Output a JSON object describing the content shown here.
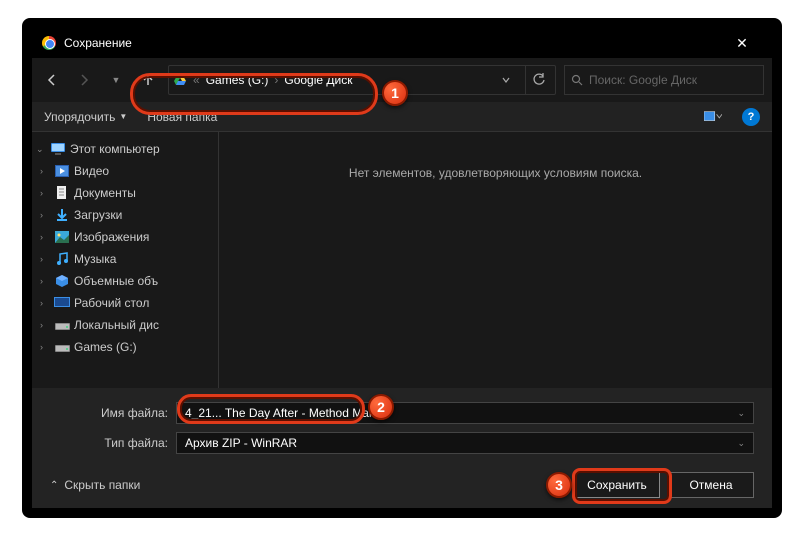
{
  "titlebar": {
    "title": "Сохранение"
  },
  "breadcrumb": {
    "prefix": "«",
    "seg1": "Games (G:)",
    "seg2": "Google Диск"
  },
  "search": {
    "placeholder": "Поиск: Google Диск"
  },
  "toolbar": {
    "organize": "Упорядочить",
    "new_folder": "Новая папка"
  },
  "sidebar": {
    "root": "Этот компьютер",
    "items": [
      {
        "label": "Видео"
      },
      {
        "label": "Документы"
      },
      {
        "label": "Загрузки"
      },
      {
        "label": "Изображения"
      },
      {
        "label": "Музыка"
      },
      {
        "label": "Объемные объ"
      },
      {
        "label": "Рабочий стол"
      },
      {
        "label": "Локальный дис"
      },
      {
        "label": "Games (G:)"
      }
    ]
  },
  "main": {
    "empty": "Нет элементов, удовлетворяющих условиям поиска."
  },
  "fields": {
    "filename_label": "Имя файла:",
    "filename_value": "4_21... The Day After - Method Man",
    "filetype_label": "Тип файла:",
    "filetype_value": "Архив ZIP - WinRAR"
  },
  "footer": {
    "hide_folders": "Скрыть папки",
    "save": "Сохранить",
    "cancel": "Отмена"
  },
  "markers": {
    "m1": "1",
    "m2": "2",
    "m3": "3"
  }
}
